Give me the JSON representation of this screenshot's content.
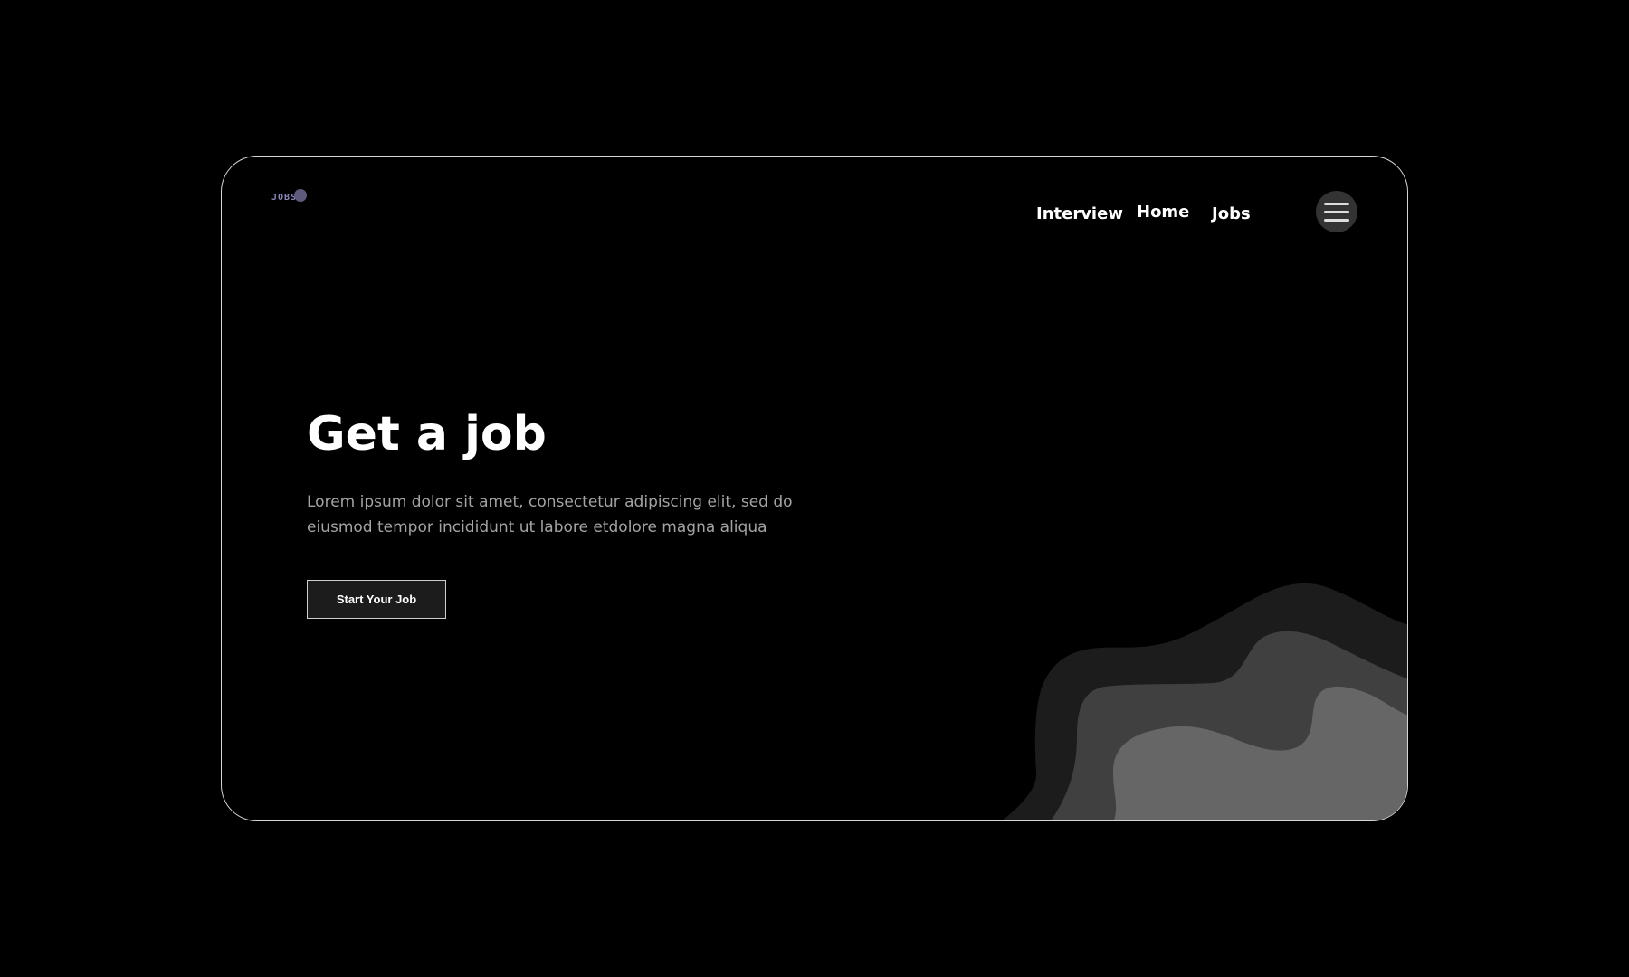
{
  "brand": {
    "logo_text": "JOBS"
  },
  "nav": {
    "items": [
      {
        "label": "Interview"
      },
      {
        "label": "Home"
      },
      {
        "label": "Jobs"
      }
    ],
    "menu_icon": "hamburger-icon"
  },
  "hero": {
    "title": "Get a job",
    "description": "Lorem ipsum dolor sit amet, consectetur adipiscing elit, sed do eiusmod tempor incididunt ut labore etdolore magna aliqua",
    "cta_label": "Start Your Job"
  },
  "colors": {
    "background": "#000000",
    "card_border": "#d6d6d6",
    "wave_dark": "#1c1c1c",
    "wave_mid": "#404040",
    "wave_light": "#666666",
    "logo_accent": "#5d5a7c"
  }
}
